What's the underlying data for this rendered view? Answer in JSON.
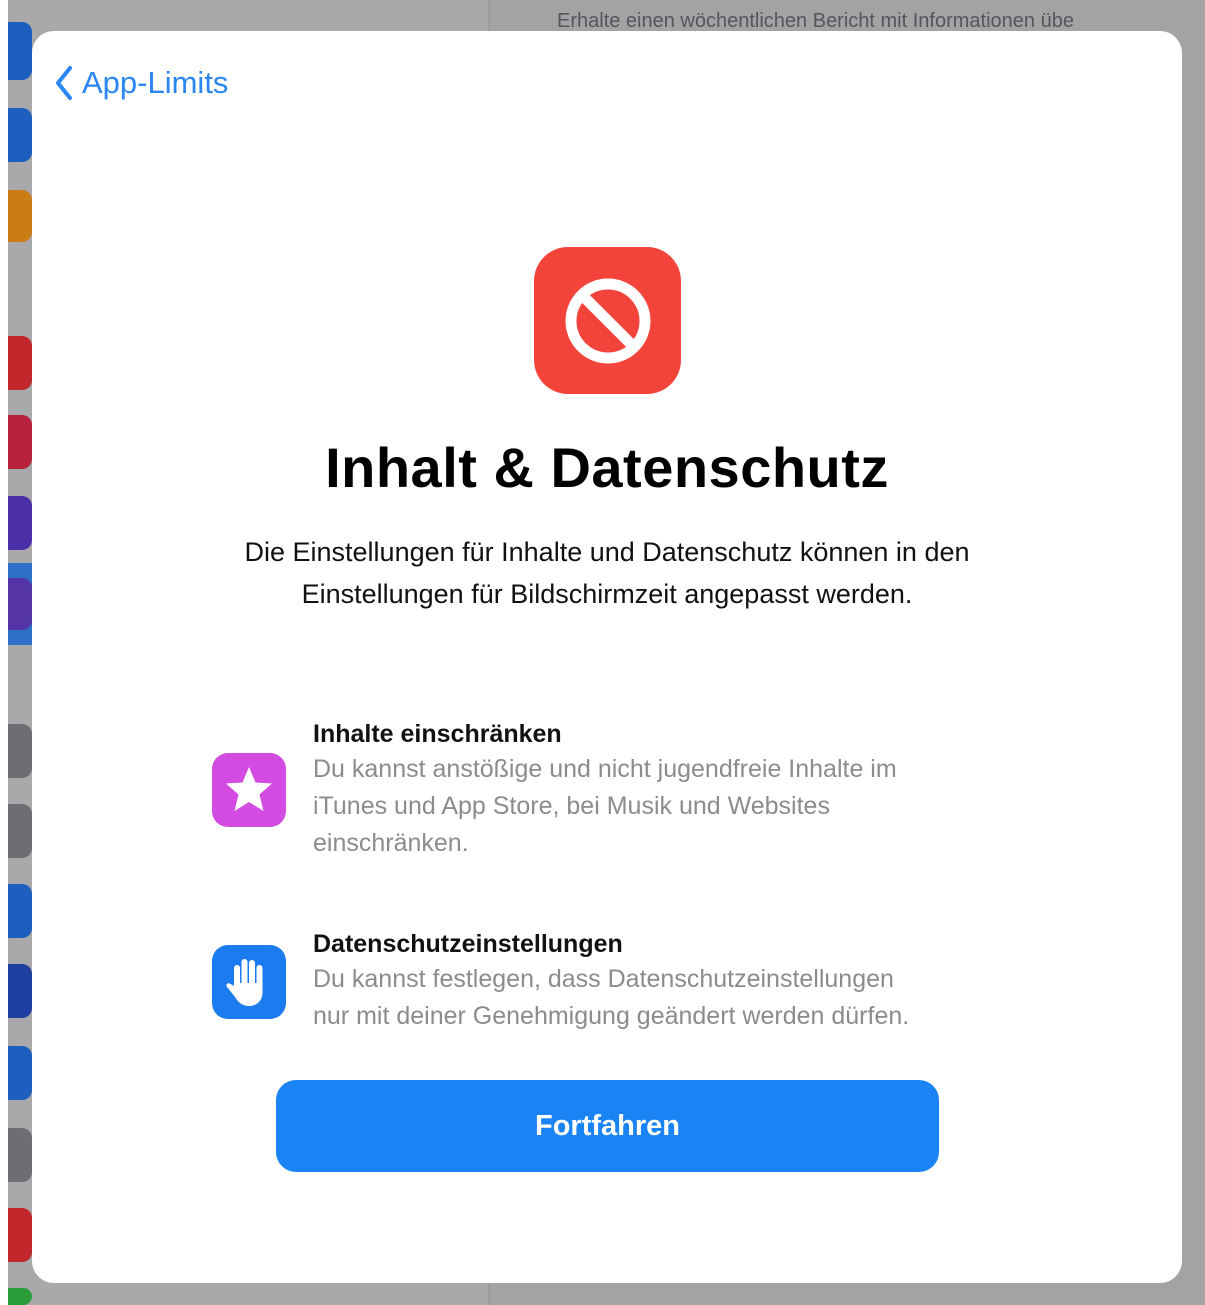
{
  "colors": {
    "accent": "#1b84f5",
    "back_link": "#2a86f1",
    "hero_icon": "#f2443a",
    "feature_1_icon": "#d34be0",
    "feature_2_icon": "#1b7cf0",
    "description_text": "#8b8b90"
  },
  "background": {
    "header_text": "Erhalte einen wöchentlichen Bericht mit Informationen übe"
  },
  "nav": {
    "back_label": "App-Limits",
    "back_icon": "chevron-left-icon"
  },
  "hero": {
    "icon": "prohibited-icon",
    "title": "Inhalt & Datenschutz",
    "subtitle": "Die Einstellungen für Inhalte und Datenschutz können in den Einstellungen für Bildschirmzeit angepasst werden."
  },
  "features": [
    {
      "icon": "star-icon",
      "title": "Inhalte einschränken",
      "description": "Du kannst anstößige und nicht jugendfreie Inhalte im\niTunes und App Store, bei Musik und Websites\neinschränken."
    },
    {
      "icon": "hand-icon",
      "title": "Datenschutzeinstellungen",
      "description": "Du kannst festlegen, dass Datenschutzeinstellungen\nnur mit deiner Genehmigung geändert werden dürfen."
    }
  ],
  "actions": {
    "continue_label": "Fortfahren"
  }
}
